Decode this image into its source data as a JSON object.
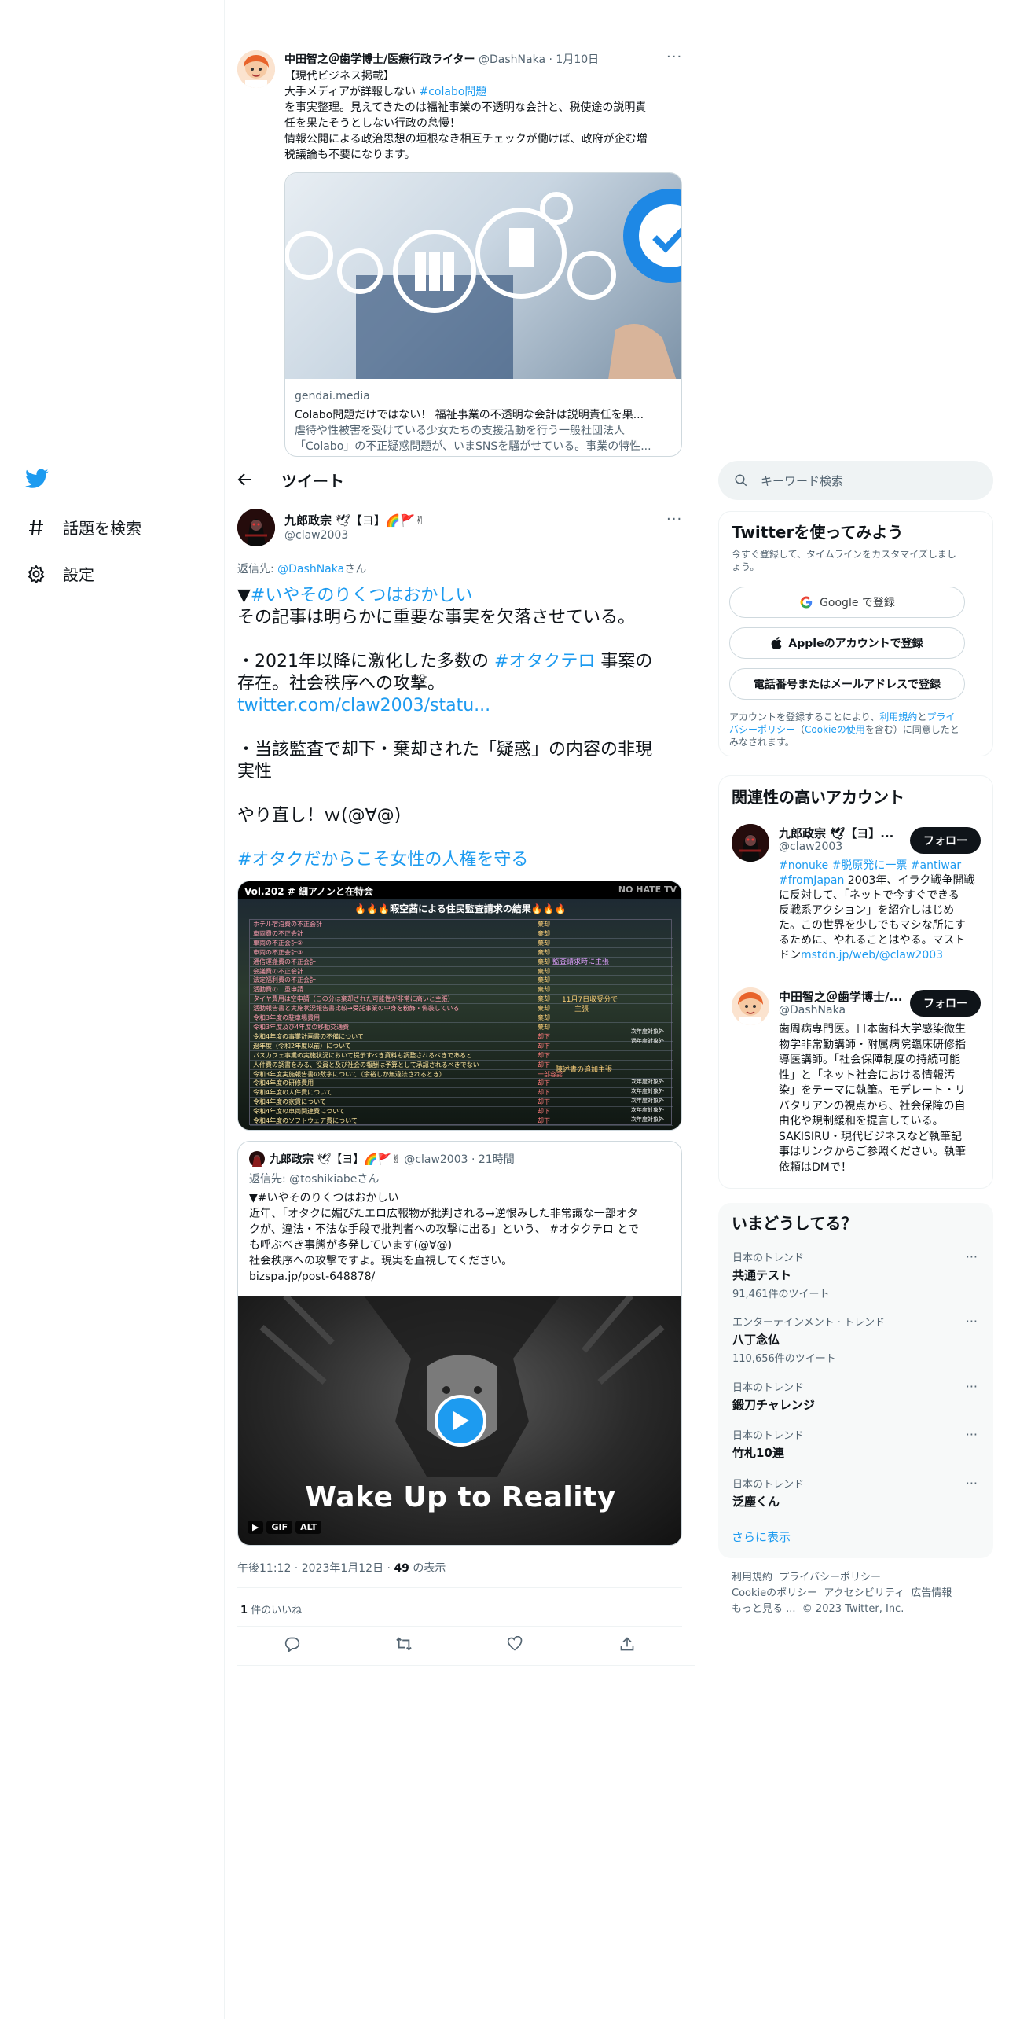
{
  "colors": {
    "accent": "#1d9bf0",
    "text": "#0f1419",
    "muted": "#536471"
  },
  "nav": {
    "home_icon": "twitter-bird-icon",
    "explore_label": "話題を検索",
    "settings_label": "設定"
  },
  "parent_tweet": {
    "author": "中田智之＠歯学博士/医療行政ライター",
    "handle": "@DashNaka",
    "sep": "·",
    "date": "1月10日",
    "line1": "【現代ビジネス掲載】",
    "line2_pre": "大手メディアが詳報しない ",
    "line2_tag": "#colabo問題",
    "line3": "を事実整理。見えてきたのは福祉事業の不透明な会計と、税使途の説明責",
    "line4": "任を果たそうとしない行政の怠慢！",
    "line5": "情報公開による政治思想の垣根なき相互チェックが働けば、政府が企む増",
    "line6": "税議論も不要になります。",
    "card_domain": "gendai.media",
    "card_title": "Colabo問題だけではない！ 福祉事業の不透明な会計は説明責任を果...",
    "card_desc1": "虐待や性被害を受けている少女たちの支援活動を行う一般社団法人",
    "card_desc2": "「Colabo」の不正疑惑問題が、いまSNSを騒がせている。事業の特性..."
  },
  "header": {
    "title": "ツイート",
    "back_icon": "back-arrow-icon"
  },
  "main_tweet": {
    "author": "九郎政宗",
    "author_suffix": "🕊【ヨ】🌈🚩✌",
    "handle": "@claw2003",
    "reply_prefix": "返信先: ",
    "reply_to": "@DashNaka",
    "reply_suffix": "さん",
    "p1_mark": "▼",
    "p1_tag": "#いやそのりくつはおかしい",
    "p1_text": "その記事は明らかに重要な事実を欠落させている。",
    "p2_pre": "・2021年以降に激化した多数の ",
    "p2_tag": "#オタクテロ",
    "p2_post": " 事案の",
    "p2_line2": "存在。社会秩序への攻撃。",
    "p2_link": "twitter.com/claw2003/statu...",
    "p3_line1": "・当該監査で却下・棄却された「疑惑」の内容の非現",
    "p3_line2": "実性",
    "p4": "やり直し！ｗ(@∀@)",
    "p5_tag": "#オタクだからこそ女性の人権を守る",
    "image_header": "Vol.202 # 細アノンと在特会",
    "image_badge": "NO HATE TV",
    "image_title": "🔥🔥🔥暇空茜による住民監査請求の結果🔥🔥🔥",
    "image_mid1": "監査請求時に主張",
    "image_mid2": "11月7日収受分で",
    "image_mid3": "主張",
    "image_mid4": "陳述書の追加主張",
    "image_rows": [
      "ホテル宿泊費の不正会計",
      "車両費の不正会計",
      "車両の不正会計②",
      "車両の不正会計③",
      "通信運搬費の不正会計",
      "会議費の不正会計",
      "法定福利費の不正会計",
      "活動費の二重申請",
      "タイヤ費用は空申請（この分は棄却された可能性が非常に高いと主張）",
      "活動報告書と実施状況報告書比較→受託事業の中身を粉飾・偽装している",
      "令和3年度の駐車場費用",
      "令和3年度及び4年度の移動交通費",
      "令和4年度の事業計画書の不備について",
      "過年度（令和2年度以前）について",
      "バスカフェ事業の実施状況において提示すべき資料も調整されるべきであると",
      "人件費の調書をみる、役員と及び社会の報酬は予算として承認されるべきでない",
      "令和3年度実施報告書の数字について（余裕しか無違法されるとき）",
      "令和4年度の研修費用",
      "令和4年度の人件費について",
      "令和4年度の家賃について",
      "令和4年度の車両関連費について",
      "令和4年度のソフトウェア費について"
    ],
    "image_status": [
      "棄却",
      "棄却",
      "棄却",
      "棄却",
      "棄却",
      "棄却",
      "棄却",
      "棄却",
      "棄却",
      "棄却",
      "棄却",
      "棄却",
      "却下",
      "却下",
      "却下",
      "却下",
      "一部容認",
      "却下",
      "却下",
      "却下",
      "却下",
      "却下"
    ],
    "image_right": [
      "次年度対象外",
      "過年度対象外",
      "次年度対象外",
      "次年度対象外",
      "次年度対象外",
      "次年度対象外",
      "次年度対象外"
    ],
    "quote": {
      "author": "九郎政宗",
      "author_suffix": "🕊【ヨ】🌈🚩✌",
      "handle": "@claw2003",
      "time": "21時間",
      "reply_prefix": "返信先: ",
      "reply_to": "@toshikiabe",
      "reply_suffix": "さん",
      "line1": "▼#いやそのりくつはおかしい",
      "line2": "近年、「オタクに媚びたエロ広報物が批判される→逆恨みした非常識な一部オタ",
      "line3": "クが、違法・不法な手段で批判者への攻撃に出る」という、 #オタクテロ とで",
      "line4": "も呼ぶべき事態が多発しています(@∀@)",
      "line5": "社会秩序への攻撃ですよ。現実を直視してください。",
      "link": "bizspa.jp/post-648878/",
      "video_caption": "Wake Up to Reality",
      "badge_gif": "GIF",
      "badge_alt": "ALT"
    },
    "timestamp": "午後11:12",
    "date": "2023年1月12日",
    "views_count": "49",
    "views_label": "の表示",
    "likes_count": "1",
    "likes_label": "件のいいね"
  },
  "search": {
    "placeholder": "キーワード検索"
  },
  "signup": {
    "title": "Twitterを使ってみよう",
    "subtitle1": "今すぐ登録して、タイムラインをカスタマイズしまし",
    "subtitle2": "ょう。",
    "google_label": "Google で登録",
    "apple_label": "Appleのアカウントで登録",
    "phone_label": "電話番号またはメールアドレスで登録",
    "legal1_pre": "アカウントを登録することにより、",
    "legal1_link": "利用規約",
    "legal1_mid": "と",
    "legal1_link2": "プライ",
    "legal2_link": "バシーポリシー",
    "legal2_pre": "（",
    "legal2_link2": "Cookieの使用",
    "legal2_post": "を含む）に同意したと",
    "legal3": "みなされます。"
  },
  "related": {
    "title": "関連性の高いアカウント",
    "accounts": [
      {
        "name": "九郎政宗 🕊【ヨ】...",
        "handle": "@claw2003",
        "follow": "フォロー",
        "bio1_tags": "#nonuke #脱原発に一票 #antiwar",
        "bio2_tag": "#fromJapan",
        "bio2_text": " 2003年、イラク戦争開戦",
        "bio3": "に反対して、「ネットで今すぐできる",
        "bio4": "反戦系アクション」を紹介しはじめ",
        "bio5": "た。この世界を少しでもマシな所にす",
        "bio6": "るために、やれることはやる。マスト",
        "bio7_pre": "ドン",
        "bio7_link": "mstdn.jp/web/@claw2003"
      },
      {
        "name": "中田智之＠歯学博士/...",
        "handle": "@DashNaka",
        "follow": "フォロー",
        "bio": [
          "歯周病専門医。日本歯科大学感染微生",
          "物学非常勤講師・附属病院臨床研修指",
          "導医講師。「社会保障制度の持続可能",
          "性」と「ネット社会における情報汚",
          "染」をテーマに執筆。モデレート・リ",
          "バタリアンの視点から、社会保障の自",
          "由化や規制緩和を提言している。",
          "SAKISIRU・現代ビジネスなど執筆記",
          "事はリンクからご参照ください。執筆",
          "依頼はDMで！"
        ]
      }
    ]
  },
  "trends": {
    "title": "いまどうしてる？",
    "items": [
      {
        "context": "日本のトレンド",
        "name": "共通テスト",
        "count": "91,461件のツイート"
      },
      {
        "context": "エンターテインメント · トレンド",
        "name": "八丁念仏",
        "count": "110,656件のツイート"
      },
      {
        "context": "日本のトレンド",
        "name": "鍛刀チャレンジ",
        "count": ""
      },
      {
        "context": "日本のトレンド",
        "name": "竹札10連",
        "count": ""
      },
      {
        "context": "日本のトレンド",
        "name": "泛塵くん",
        "count": ""
      }
    ],
    "more": "さらに表示"
  },
  "footer": {
    "l1a": "利用規約",
    "l1b": "プライバシーポリシー",
    "l2a": "Cookieのポリシー",
    "l2b": "アクセシビリティ",
    "l2c": "広告情報",
    "l3a": "もっと見る ...",
    "l3b": "© 2023 Twitter, Inc."
  }
}
